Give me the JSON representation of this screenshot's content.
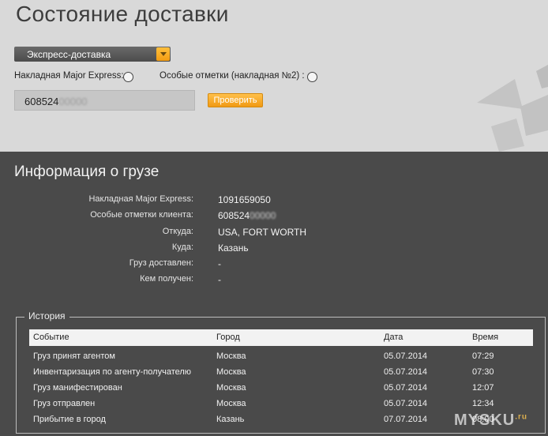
{
  "page": {
    "title": "Состояние доставки"
  },
  "form": {
    "service_select": "Экспресс-доставка",
    "radio_major_label": "Накладная Major Express:",
    "radio_notes_label": "Особые отметки (накладная №2) :",
    "tracking_visible": "608524",
    "tracking_obscured": "00000",
    "check_button": "Проверить"
  },
  "info": {
    "title": "Информация о грузе",
    "rows": [
      {
        "label": "Накладная Major Express:",
        "value": "1091659050"
      },
      {
        "label": "Особые отметки клиента:",
        "value": "608524",
        "obscured": "00000"
      },
      {
        "label": "Откуда:",
        "value": "USA, FORT WORTH"
      },
      {
        "label": "Куда:",
        "value": "Казань"
      },
      {
        "label": "Груз доставлен:",
        "value": "-"
      },
      {
        "label": "Кем получен:",
        "value": "-"
      }
    ]
  },
  "history": {
    "legend": "История",
    "columns": [
      "Событие",
      "Город",
      "Дата",
      "Время"
    ],
    "rows": [
      [
        "Груз принят агентом",
        "Москва",
        "05.07.2014",
        "07:29"
      ],
      [
        "Инвентаризация по агенту-получателю",
        "Москва",
        "05.07.2014",
        "07:30"
      ],
      [
        "Груз манифестирован",
        "Москва",
        "05.07.2014",
        "12:07"
      ],
      [
        "Груз отправлен",
        "Москва",
        "05.07.2014",
        "12:34"
      ],
      [
        "Прибытие в город",
        "Казань",
        "07.07.2014",
        "08:00"
      ]
    ]
  },
  "watermark": {
    "text": "MYSKU",
    "suffix": ".ru"
  },
  "colors": {
    "accent": "#f39c12",
    "top_bg": "#d9d9d9",
    "bottom_bg": "#4a4a4a"
  }
}
